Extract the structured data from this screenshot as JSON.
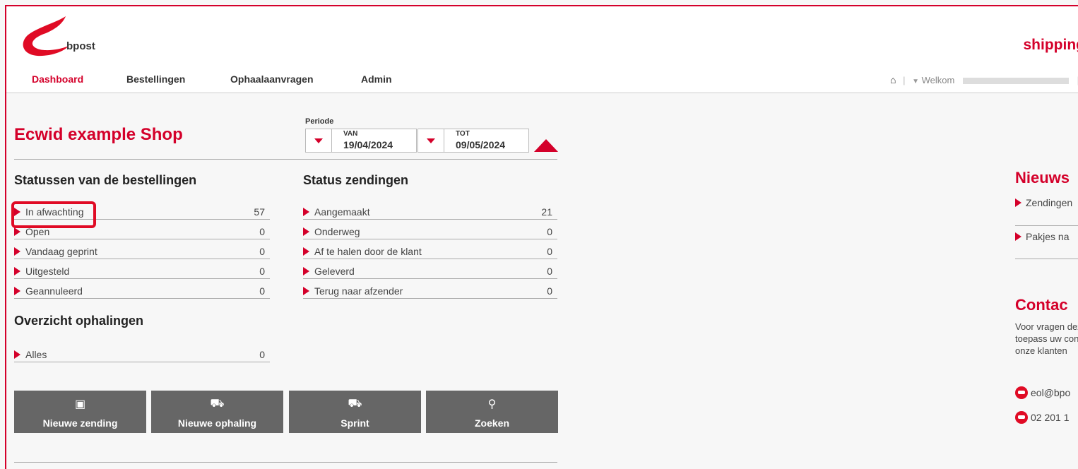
{
  "header": {
    "logo_text": "bpost",
    "app_title": "shipping",
    "nav": [
      "Dashboard",
      "Bestellingen",
      "Ophaalaanvragen",
      "Admin"
    ],
    "welcome": "Welkom"
  },
  "shop": {
    "title": "Ecwid example Shop",
    "periode": "Periode",
    "from_label": "VAN",
    "from_value": "19/04/2024",
    "to_label": "TOT",
    "to_value": "09/05/2024"
  },
  "order_status": {
    "title": "Statussen van de bestellingen",
    "items": [
      {
        "label": "In afwachting",
        "count": "57"
      },
      {
        "label": "Open",
        "count": "0"
      },
      {
        "label": "Vandaag geprint",
        "count": "0"
      },
      {
        "label": "Uitgesteld",
        "count": "0"
      },
      {
        "label": "Geannuleerd",
        "count": "0"
      }
    ]
  },
  "shipment_status": {
    "title": "Status zendingen",
    "items": [
      {
        "label": "Aangemaakt",
        "count": "21"
      },
      {
        "label": "Onderweg",
        "count": "0"
      },
      {
        "label": "Af te halen door de klant",
        "count": "0"
      },
      {
        "label": "Geleverd",
        "count": "0"
      },
      {
        "label": "Terug naar afzender",
        "count": "0"
      }
    ]
  },
  "pickups": {
    "title": "Overzicht ophalingen",
    "items": [
      {
        "label": "Alles",
        "count": "0"
      }
    ]
  },
  "actions": [
    "Nieuwe zending",
    "Nieuwe ophaling",
    "Sprint",
    "Zoeken"
  ],
  "news": {
    "title": "Nieuws",
    "items": [
      "Zendingen",
      "Pakjes na"
    ]
  },
  "contact": {
    "title": "Contac",
    "text": "Voor vragen deze toepass uw contract, onze klanten",
    "email": "eol@bpo",
    "phone": "02 201 1"
  },
  "colors": {
    "accent": "#d4002a",
    "button": "#666666"
  }
}
